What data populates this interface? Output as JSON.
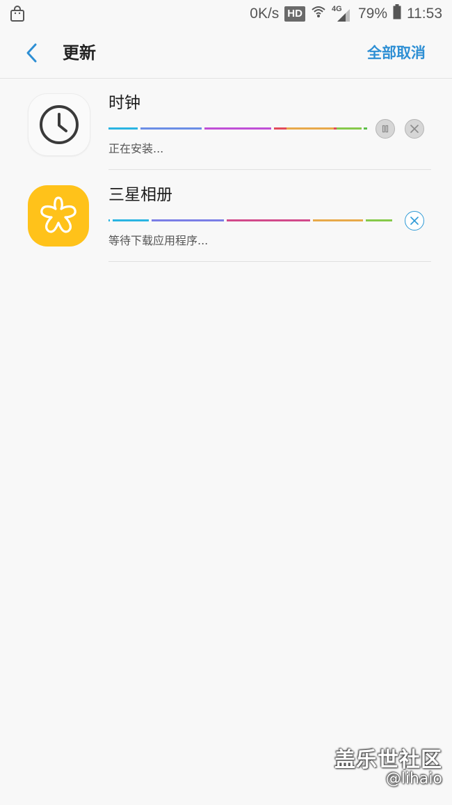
{
  "status_bar": {
    "net_speed": "0K/s",
    "hd_badge": "HD",
    "network_type": "4G",
    "battery_percent": "79%",
    "time": "11:53",
    "icons": [
      "shopping-bag-icon",
      "wifi-icon",
      "signal-icon",
      "battery-icon"
    ]
  },
  "app_bar": {
    "title": "更新",
    "cancel_all_label": "全部取消",
    "accent_color": "#2e8fd4"
  },
  "updates": [
    {
      "name": "时钟",
      "status": "正在安装...",
      "icon": "clock-icon",
      "actions": [
        "pause",
        "cancel"
      ]
    },
    {
      "name": "三星相册",
      "status": "等待下载应用程序...",
      "icon": "gallery-flower-icon",
      "actions": [
        "cancel"
      ]
    }
  ],
  "watermark": {
    "site": "盖乐世社区",
    "user": "@lihaio"
  }
}
